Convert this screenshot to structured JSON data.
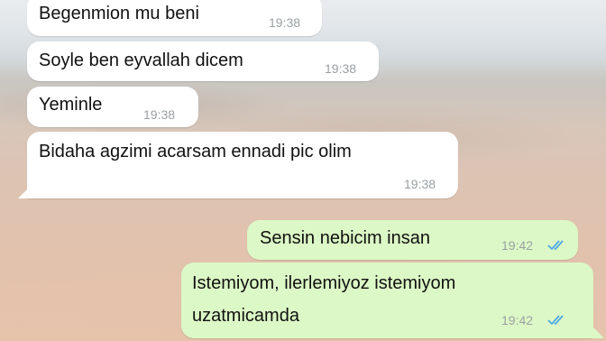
{
  "chat": {
    "incoming": [
      {
        "text": "Begenmion mu beni",
        "time": "19:38"
      },
      {
        "text": "Soyle ben eyvallah dicem",
        "time": "19:38"
      },
      {
        "text": "Yeminle",
        "time": "19:38"
      },
      {
        "text": "Bidaha agzimi acarsam ennadi pic olim",
        "time": "19:38"
      }
    ],
    "outgoing": [
      {
        "text": "Sensin nebicim insan",
        "time": "19:42",
        "status_icon": "double-check-read-icon"
      },
      {
        "lines": [
          "Istemiyom, ilerlemiyoz istemiyom",
          "uzatmicamda"
        ],
        "time": "19:42",
        "status_icon": "double-check-read-icon"
      }
    ]
  },
  "colors": {
    "incoming_bubble": "#ffffff",
    "outgoing_bubble": "#dcf8c6",
    "read_ticks": "#4fa8e6",
    "timestamp": "#9aa0a3"
  }
}
